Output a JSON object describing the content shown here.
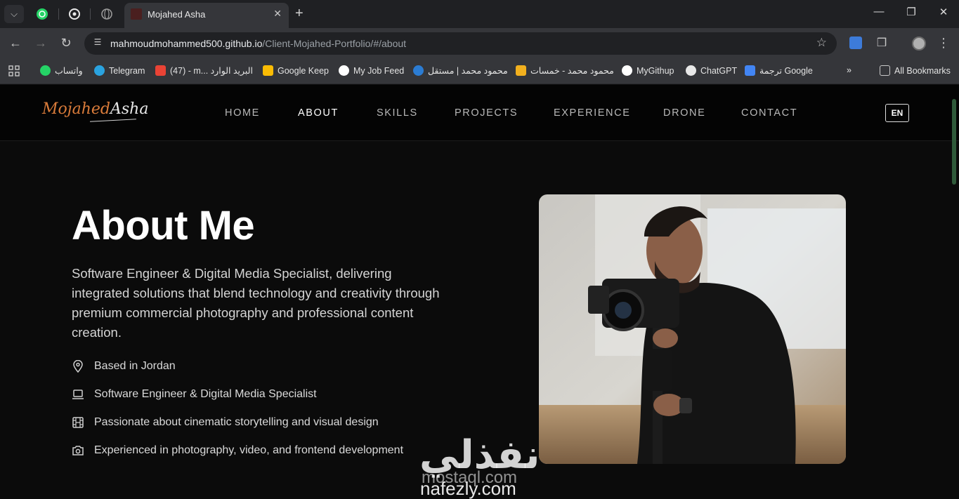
{
  "browser": {
    "active_tab_title": "Mojahed Asha",
    "url_host": "mahmoudmohammed500.github.io",
    "url_path": "/Client-Mojahed-Portfolio/#/about",
    "bookmarks": [
      {
        "label": "واتساب",
        "icon": "whatsapp-icon",
        "color": "#25d366"
      },
      {
        "label": "Telegram",
        "icon": "telegram-icon",
        "color": "#2aa3e0"
      },
      {
        "label": "(47) - m... البريد الوارد",
        "icon": "gmail-icon",
        "color": "#ea4335"
      },
      {
        "label": "Google Keep",
        "icon": "keep-icon",
        "color": "#fbbc04"
      },
      {
        "label": "My Job Feed",
        "icon": "upwork-icon",
        "color": "#ffffff"
      },
      {
        "label": "محمود محمد | مستقل",
        "icon": "mostaql-icon",
        "color": "#2b7cd3"
      },
      {
        "label": "محمود محمد - خمسات",
        "icon": "khamsat-icon",
        "color": "#f2b01e"
      },
      {
        "label": "MyGithup",
        "icon": "github-icon",
        "color": "#ffffff"
      },
      {
        "label": "ChatGPT",
        "icon": "chatgpt-icon",
        "color": "#ffffff"
      },
      {
        "label": "ترجمة Google",
        "icon": "translate-icon",
        "color": "#4285f4"
      }
    ],
    "all_bookmarks_label": "All Bookmarks"
  },
  "site": {
    "logo_first": "Mojahed",
    "logo_last": "Asha",
    "nav": [
      "HOME",
      "ABOUT",
      "SKILLS",
      "PROJECTS",
      "EXPERIENCE",
      "DRONE",
      "CONTACT"
    ],
    "active_nav": "ABOUT",
    "lang_button": "EN",
    "heading": "About Me",
    "lead": "Software Engineer & Digital Media Specialist, delivering integrated solutions that blend technology and creativity through premium commercial photography and professional content creation.",
    "facts": [
      {
        "icon": "location-pin-icon",
        "text": "Based in Jordan"
      },
      {
        "icon": "laptop-icon",
        "text": "Software Engineer & Digital Media Specialist"
      },
      {
        "icon": "film-icon",
        "text": "Passionate about cinematic storytelling and visual design"
      },
      {
        "icon": "camera-icon",
        "text": "Experienced in photography, video, and frontend development"
      }
    ],
    "photo_alt": "Man filming with camera on gimbal"
  },
  "watermark": {
    "arabic": "نفذلي",
    "mostaql": "mostaql.com",
    "nafezly": "nafezly.com"
  }
}
